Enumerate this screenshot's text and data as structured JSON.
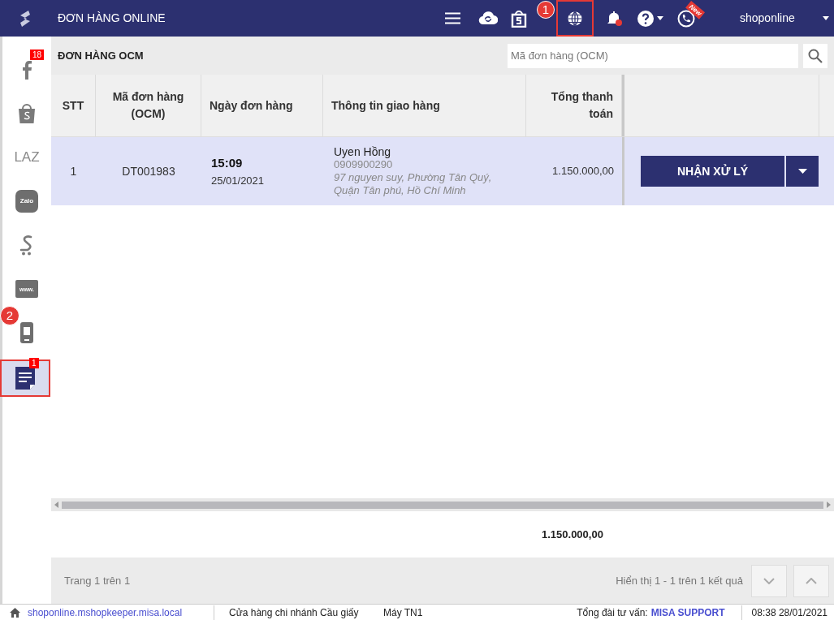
{
  "header": {
    "title": "ĐƠN HÀNG ONLINE",
    "new_ribbon": "New",
    "user": "shoponline",
    "callout": "1"
  },
  "sidebar": {
    "callout": "2",
    "items": [
      {
        "kind": "facebook",
        "badge": "18",
        "selected": false
      },
      {
        "kind": "shopee",
        "selected": false
      },
      {
        "kind": "text",
        "label": "LAZ",
        "selected": false
      },
      {
        "kind": "zalo",
        "label": "Zalo",
        "selected": false
      },
      {
        "kind": "sendo",
        "selected": false
      },
      {
        "kind": "web",
        "label": "www.",
        "selected": false
      },
      {
        "kind": "mobile",
        "selected": false
      },
      {
        "kind": "notes",
        "badge": "1",
        "selected": true
      }
    ]
  },
  "panel": {
    "title": "ĐƠN HÀNG OCM",
    "search": {
      "placeholder": "Mã đơn hàng (OCM)"
    }
  },
  "table": {
    "columns": [
      "STT",
      "Mã đơn hàng (OCM)",
      "Ngày đơn hàng",
      "Thông tin giao hàng",
      "Tổng thanh toán"
    ],
    "rows": [
      {
        "stt": "1",
        "code": "DT001983",
        "time": "15:09",
        "date": "25/01/2021",
        "name": "Uyen Hồng",
        "phone": "0909900290",
        "address": "97 nguyen suy, Phường Tân Quý, Quận Tân phú, Hồ Chí Minh",
        "total": "1.150.000,00",
        "action": "NHẬN XỬ LÝ",
        "selected": true
      }
    ],
    "sum": "1.150.000,00"
  },
  "pager": {
    "page": "Trang 1 trên 1",
    "summary": "Hiển thị 1 - 1 trên 1 kết quả"
  },
  "status_bar": {
    "url": "shoponline.mshopkeeper.misa.local",
    "branch": "Cửa hàng chi nhánh Cầu giấy",
    "machine": "Máy TN1",
    "hotline_label": "Tổng đài tư vấn:",
    "hotline": "MISA SUPPORT",
    "datetime": "08:38 28/01/2021"
  }
}
